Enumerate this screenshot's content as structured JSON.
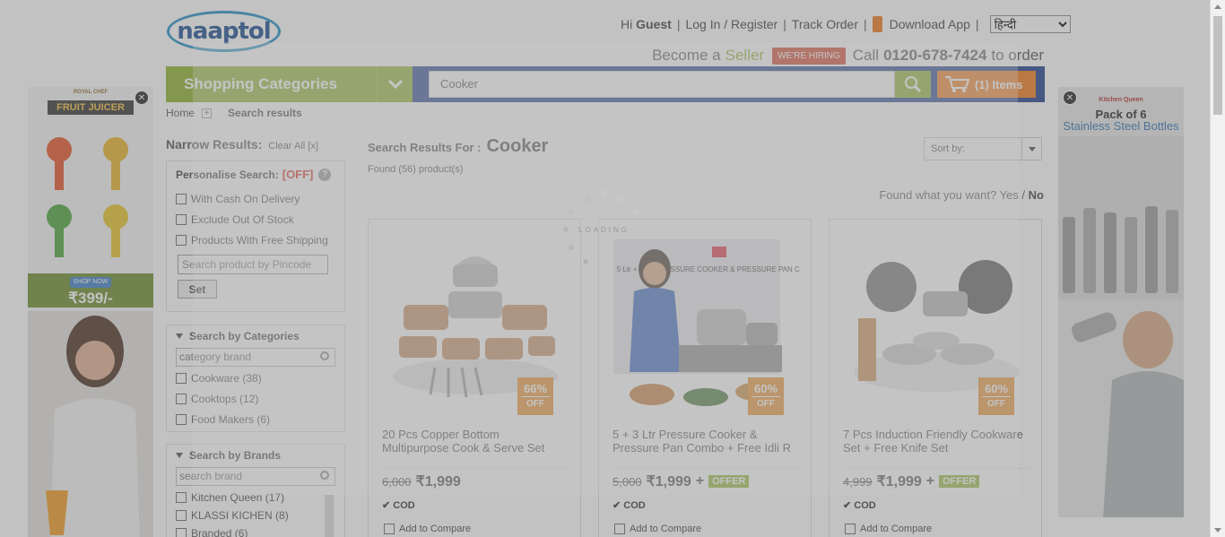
{
  "header": {
    "logo": "naaptol",
    "greeting_prefix": "Hi",
    "greeting_name": "Guest",
    "login": "Log In / Register",
    "track": "Track Order",
    "download": "Download App",
    "language": "हिन्दी",
    "seller_prefix": "Become a",
    "seller_word": "Seller",
    "hiring": "WE'RE HIRING",
    "call_prefix": "Call",
    "call_number": "0120-678-7424",
    "call_suffix": "to order"
  },
  "nav": {
    "categories": "Shopping Categories",
    "search_value": "Cooker",
    "cart": "(1) Items"
  },
  "breadcrumb": {
    "home": "Home",
    "current": "Search results"
  },
  "sidebar": {
    "narrow": "Narrow Results:",
    "clear": "Clear All [x]",
    "personalise": "Personalise Search:",
    "personalise_state": "[OFF]",
    "options": [
      "With Cash On Delivery",
      "Exclude Out Of Stock",
      "Products With Free Shipping"
    ],
    "pincode_placeholder": "Search product by Pincode",
    "set": "Set",
    "categories_title": "Search by Categories",
    "categories_placeholder": "category brand",
    "categories": [
      "Cookware (38)",
      "Cooktops (12)",
      "Food Makers (6)"
    ],
    "brands_title": "Search by Brands",
    "brands_placeholder": "search brand",
    "brands": [
      "Kitchen Queen (17)",
      "KLASSI KICHEN (8)",
      "Branded (6)"
    ]
  },
  "main": {
    "results_for": "Search Results For :",
    "query": "Cooker",
    "found": "Found (56) product(s)",
    "sort": "Sort by:",
    "found_want": "Found what you want?",
    "yes": "Yes",
    "no": "No",
    "loading": "LOADING"
  },
  "products": [
    {
      "name": "20 Pcs Copper Bottom",
      "name2": "Multipurpose Cook & Serve Set",
      "old": "6,000",
      "price": "₹1,999",
      "discount": "66%",
      "off": "OFF",
      "offer": "",
      "cod": "COD",
      "compare": "Add to Compare"
    },
    {
      "name": "5 + 3 Ltr Pressure Cooker &",
      "name2": "Pressure Pan Combo + Free Idli R",
      "old": "5,000",
      "price": "₹1,999",
      "discount": "60%",
      "off": "OFF",
      "offer": "OFFER",
      "cod": "COD",
      "compare": "Add to Compare"
    },
    {
      "name": "7 Pcs Induction Friendly Cookware",
      "name2": "Set + Free Knife Set",
      "old": "4,999",
      "price": "₹1,999",
      "discount": "60%",
      "off": "OFF",
      "offer": "OFFER",
      "cod": "COD",
      "compare": "Add to Compare"
    }
  ],
  "ads": {
    "left_brand": "ROYAL CHEF",
    "left_title": "FRUIT JUICER",
    "left_shop": "SHOP NOW",
    "left_price": "₹399/-",
    "right_brand": "Kitchen Queen",
    "right_title1": "Pack of 6",
    "right_title2": "Stainless Steel Bottles"
  },
  "product_image_text": "5 Ltr + 3 Ltr PRESSURE COOKER & PRESSURE PAN COMBO",
  "colors": {
    "green": "#8db22b",
    "navy": "#1e3f8c",
    "orange": "#f07a1a",
    "red": "#cf3a1e"
  }
}
